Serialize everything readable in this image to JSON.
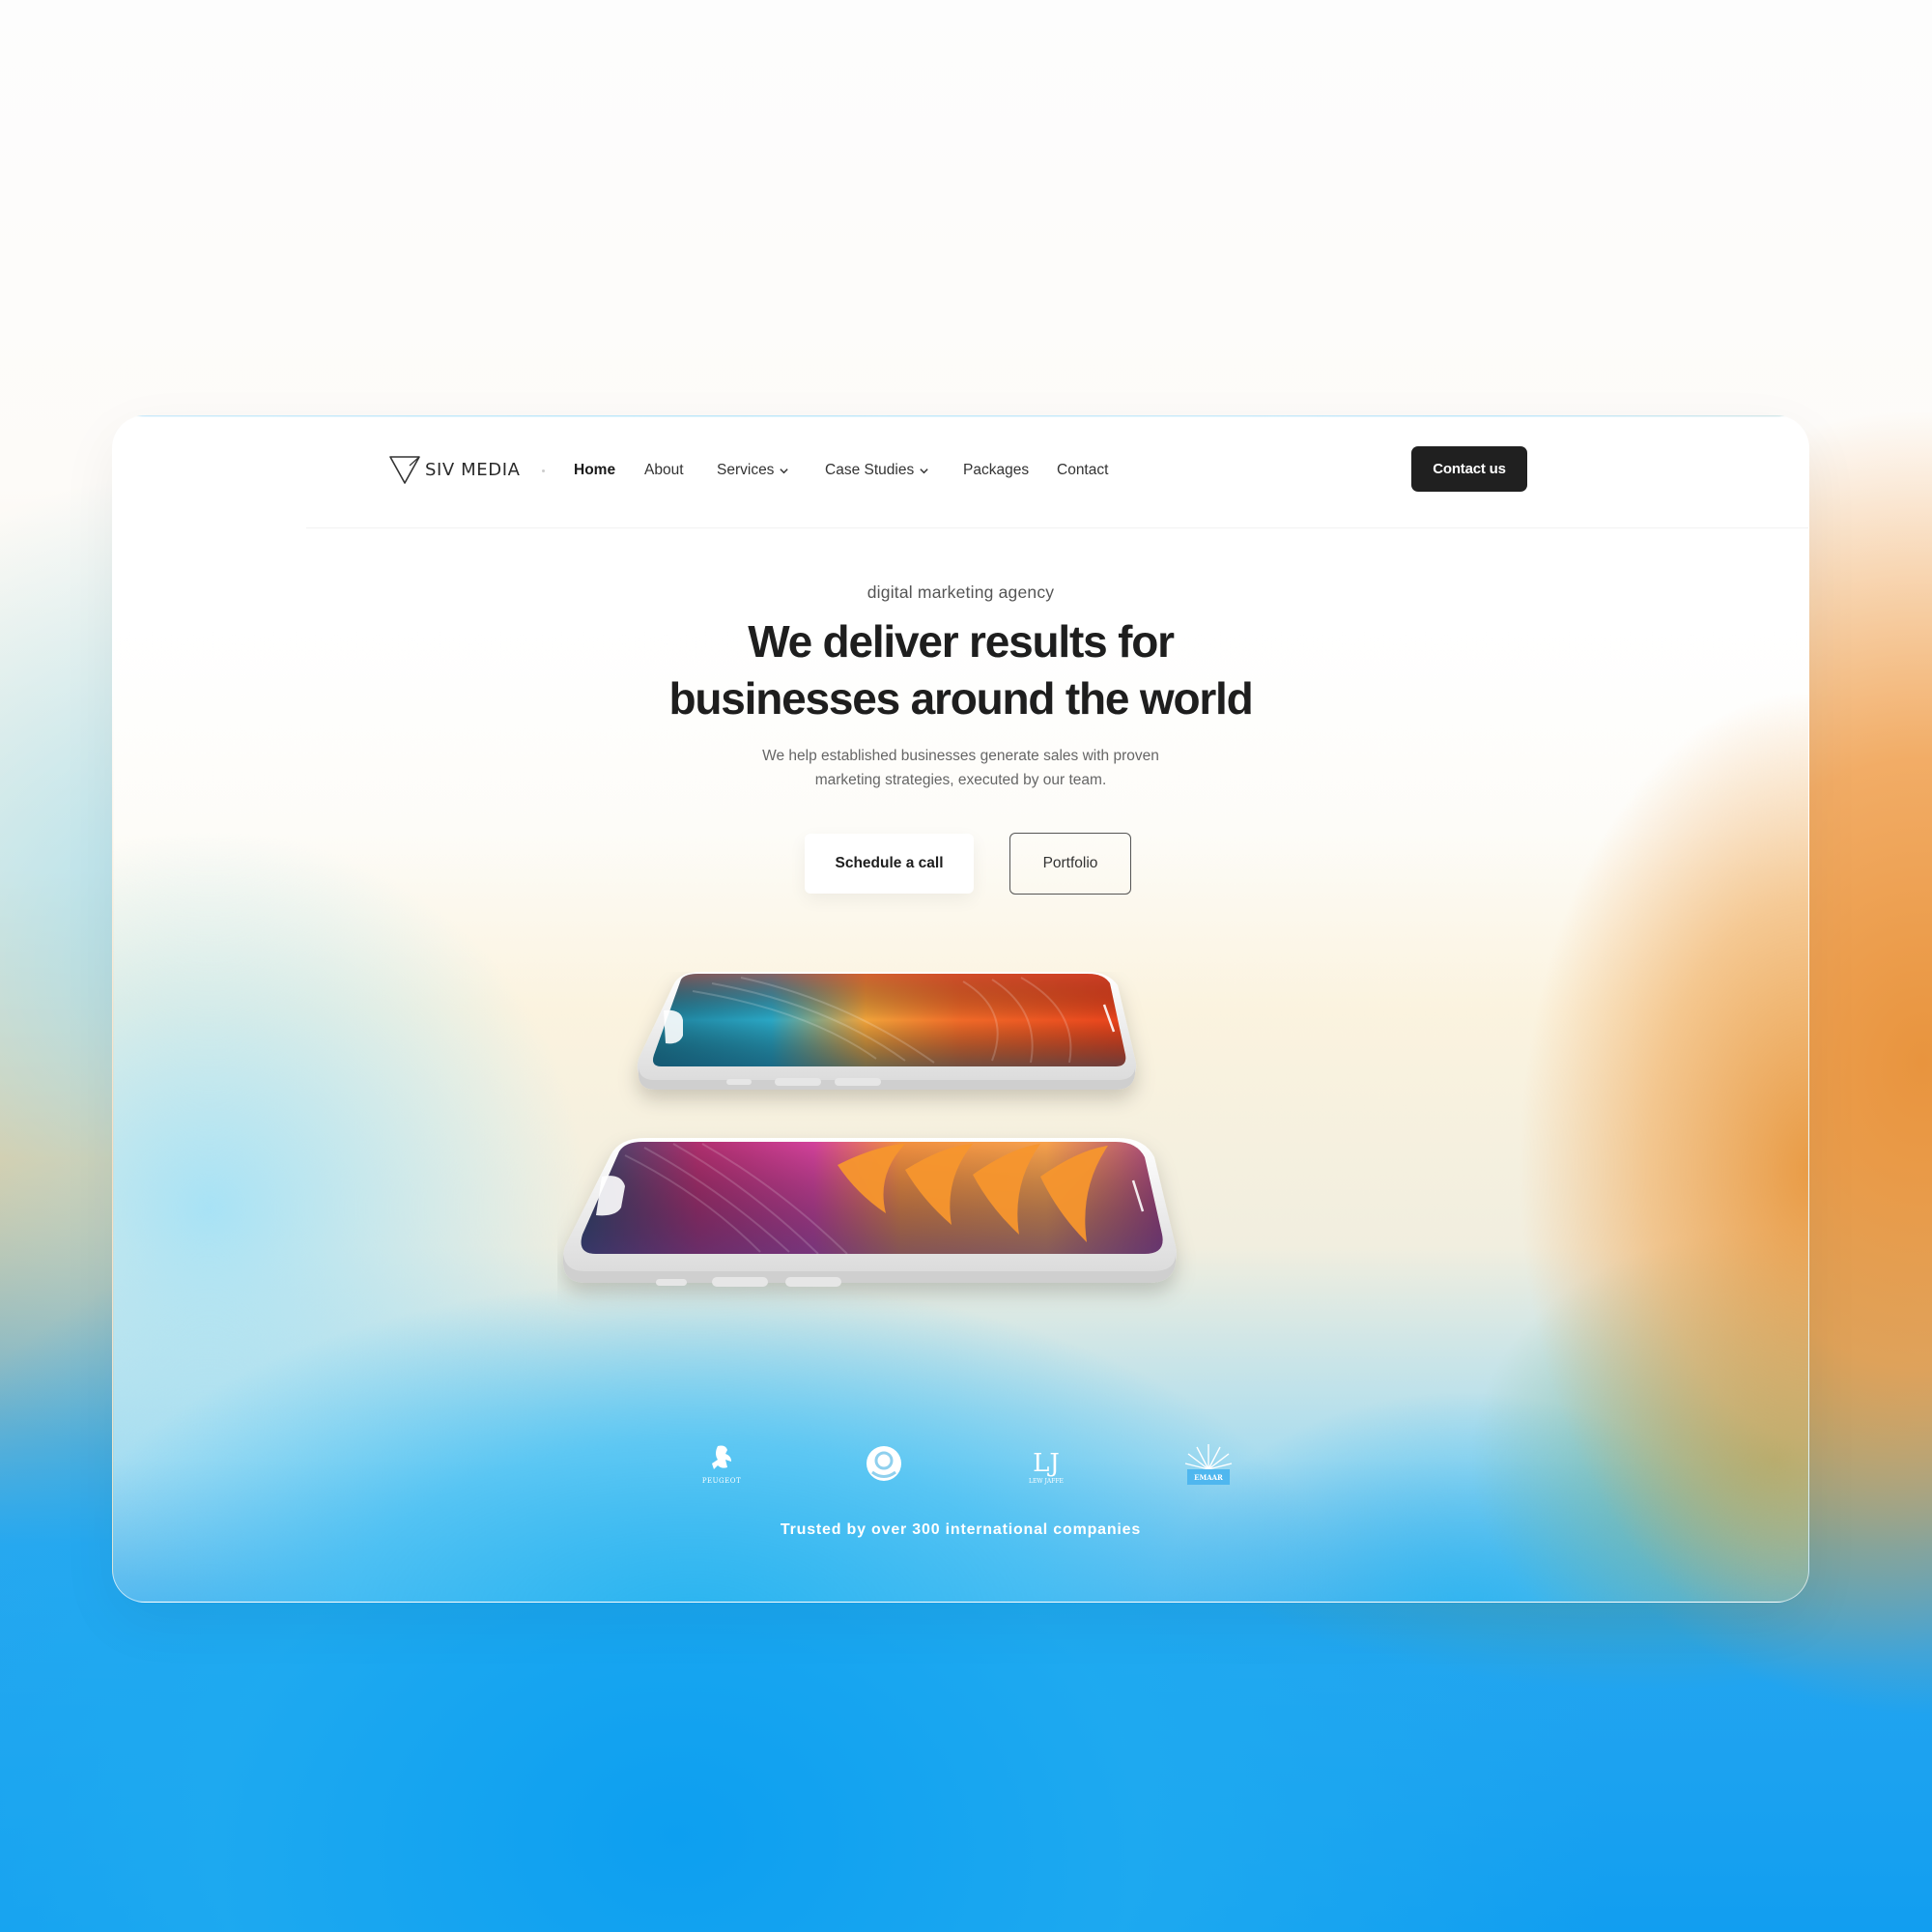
{
  "brand": {
    "name": "SIV MEDIA",
    "logo_icon": "triangle-logo-icon"
  },
  "nav": {
    "items": [
      {
        "label": "Home",
        "active": true
      },
      {
        "label": "About"
      },
      {
        "label": "Services",
        "has_dropdown": true
      },
      {
        "label": "Case Studies",
        "has_dropdown": true
      },
      {
        "label": "Packages"
      },
      {
        "label": "Contact"
      }
    ],
    "cta_label": "Contact us"
  },
  "hero": {
    "eyebrow": "digital marketing agency",
    "headline_line1": "We deliver results for",
    "headline_line2": "businesses around the world",
    "sub_line1": "We help established businesses generate sales with proven",
    "sub_line2": "marketing strategies, executed by our team.",
    "primary_button": "Schedule a call",
    "secondary_button": "Portfolio"
  },
  "clients": {
    "logos": [
      "peugeot-logo",
      "circle-face-logo",
      "lew-jaffe-logo",
      "emaar-logo"
    ],
    "peugeot_text": "PEUGEOT",
    "lj_text": "LEW JAFFE",
    "emaar_text": "EMAAR",
    "trusted_text": "Trusted by over 300 international companies"
  },
  "colors": {
    "dark": "#202020",
    "accent_orange": "#e8943e",
    "accent_blue": "#119ef0"
  }
}
